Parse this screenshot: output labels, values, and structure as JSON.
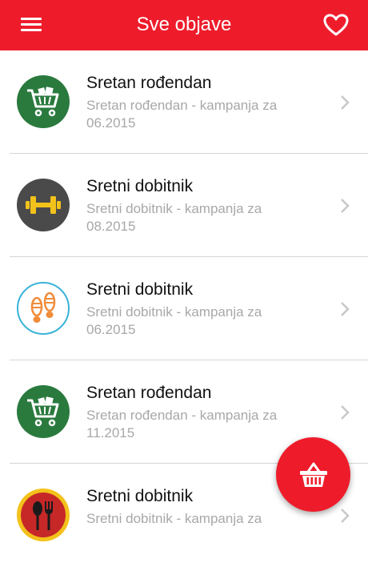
{
  "header": {
    "title": "Sve objave",
    "menu_icon": "hamburger-menu-icon",
    "favorite_icon": "heart-icon",
    "background": "#ee1c2b"
  },
  "posts": [
    {
      "title": "Sretan rođendan",
      "subtitle": "Sretan rođendan - kampanja za 06.2015",
      "icon": "shopping-cart-icon",
      "icon_bg": "#2a7a3e"
    },
    {
      "title": "Sretni dobitnik",
      "subtitle": "Sretni dobitnik - kampanja za 08.2015",
      "icon": "dumbbell-icon",
      "icon_bg": "#4a4a4a"
    },
    {
      "title": "Sretni dobitnik",
      "subtitle": "Sretni dobitnik - kampanja za 06.2015",
      "icon": "footprints-icon",
      "icon_bg": "#ffffff"
    },
    {
      "title": "Sretan rođendan",
      "subtitle": "Sretan rođendan - kampanja za 11.2015",
      "icon": "shopping-cart-icon",
      "icon_bg": "#2a7a3e"
    },
    {
      "title": "Sretni dobitnik",
      "subtitle": "Sretni dobitnik - kampanja za",
      "icon": "spoon-fork-icon",
      "icon_bg": "#f2c21b"
    }
  ],
  "fab": {
    "icon": "basket-icon",
    "color": "#ee1c2b"
  }
}
